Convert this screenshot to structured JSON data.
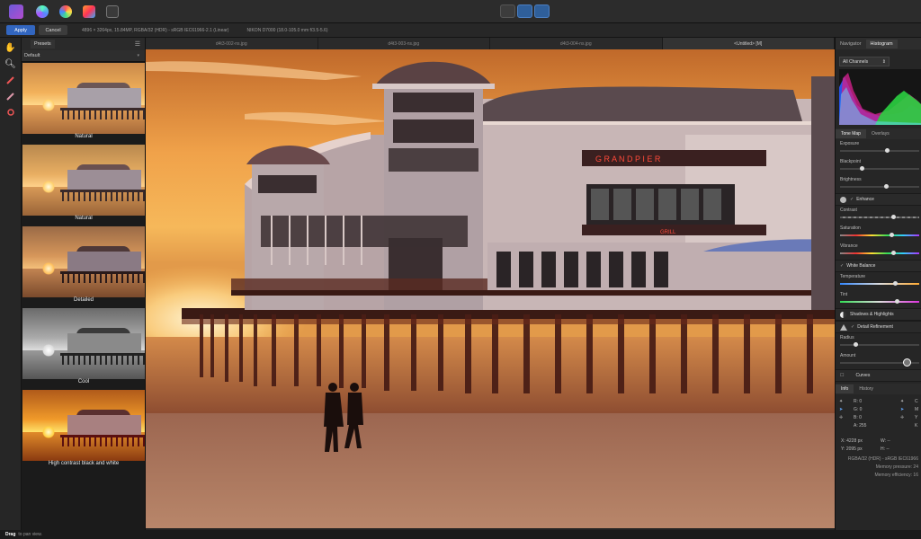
{
  "toolbar": {
    "personas": [
      "photo-persona-icon",
      "liquify-persona-icon",
      "develop-persona-icon",
      "tone-mapping-persona-icon",
      "export-persona-icon"
    ],
    "center_icons": [
      "view-mode-icon",
      "split-view-icon",
      "mirror-view-icon"
    ]
  },
  "context": {
    "apply": "Apply",
    "cancel": "Cancel",
    "info": "4896 × 3264px, 15.84MP, RGBA/32 (HDR) - sRGB IEC61966-2.1 (Linear)",
    "camera": "NIKON D7000 (18.0-105.0 mm f/3.5-5.6)"
  },
  "presets": {
    "tab": "Presets",
    "category": "Default",
    "items": [
      {
        "label": "Natural"
      },
      {
        "label": "Natural"
      },
      {
        "label": "Detailed"
      },
      {
        "label": "Cool"
      },
      {
        "label": "High contrast black and white"
      }
    ]
  },
  "doctabs": [
    "d4t3-002-ns.jpg",
    "d4t3-003-ns.jpg",
    "d4t3-004-ns.jpg",
    "<Untitled> [M]"
  ],
  "canvas": {
    "sign": "G R A N D   P I E R",
    "sign2": "GRILL"
  },
  "right": {
    "tabs": [
      "Navigator",
      "Histogram"
    ],
    "channel": "All Channels",
    "subtabs": [
      "Tone Map",
      "Overlays"
    ],
    "sliders1": [
      {
        "label": "Exposure",
        "value": 0.6
      },
      {
        "label": "Blackpoint",
        "value": 0.28
      },
      {
        "label": "Brightness",
        "value": 0.58
      }
    ],
    "enhance": "Enhance",
    "sliders2": [
      {
        "label": "Contrast",
        "value": 0.68
      },
      {
        "label": "Saturation",
        "value": 0.65
      },
      {
        "label": "Vibrance",
        "value": 0.68
      }
    ],
    "white_balance": "White Balance",
    "sliders3": [
      {
        "label": "Temperature",
        "value": 0.7
      },
      {
        "label": "Tint",
        "value": 0.72
      }
    ],
    "shadows": "Shadows & Highlights",
    "detail": "Detail Refinement",
    "sliders4": [
      {
        "label": "Radius",
        "value": 0.2
      },
      {
        "label": "Amount",
        "value": 0.85
      }
    ],
    "curves": "Curves",
    "info_tabs": [
      "Info",
      "History"
    ],
    "info_rows": [
      {
        "k": "R:",
        "v": "0"
      },
      {
        "k": "G:",
        "v": "0"
      },
      {
        "k": "B:",
        "v": "0"
      },
      {
        "k": "A:",
        "v": "255"
      }
    ],
    "info_rows_right": [
      {
        "k": "C"
      },
      {
        "k": "M"
      },
      {
        "k": "Y"
      },
      {
        "k": "K"
      }
    ],
    "coords": {
      "x": "X: 4228 px",
      "y": "Y: 2095 px",
      "w": "W: --",
      "h": "H: --"
    },
    "footer": [
      "RGBA/32 (HDR) - sRGB IEC61966",
      "Memory pressure: 24",
      "Memory efficiency: 16"
    ]
  },
  "status": {
    "bold": "Drag",
    "text": "to pan view."
  }
}
